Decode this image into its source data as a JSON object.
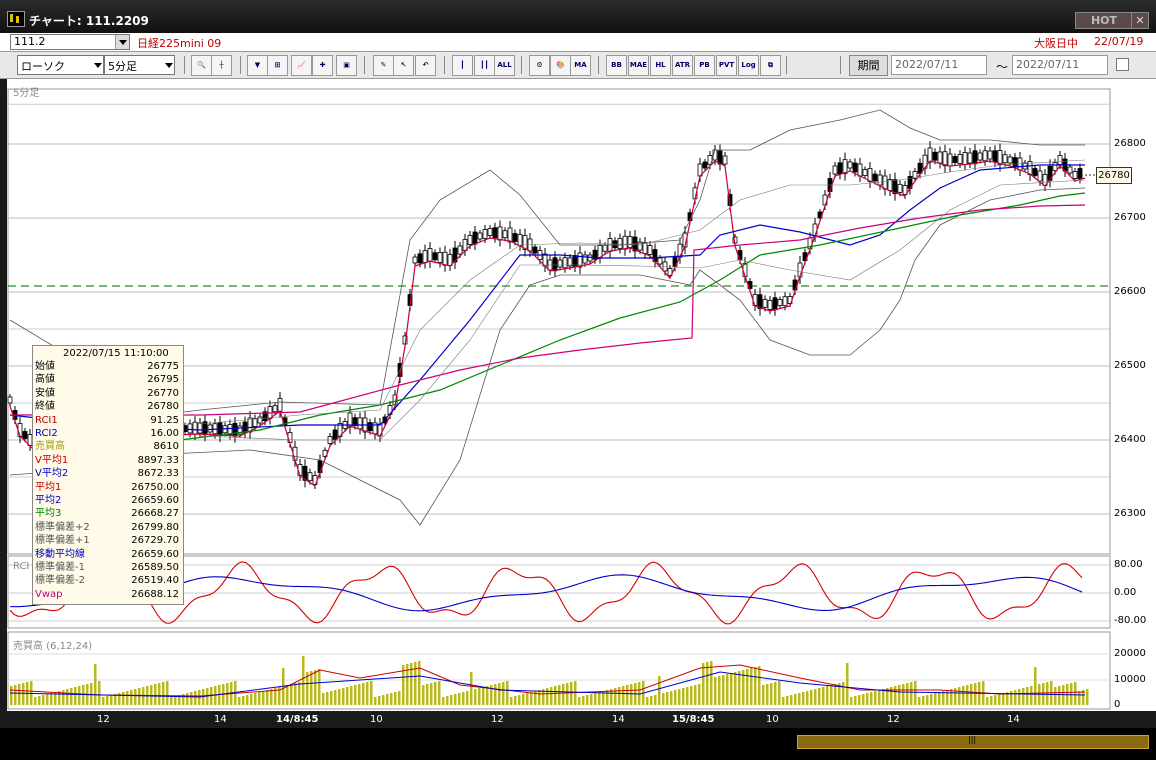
{
  "window": {
    "title": "チャート: 111.2209",
    "hot_label": "HOT",
    "close_glyph": "✕"
  },
  "header": {
    "symbol_code": "111.2",
    "contract_name": "日経225mini 09",
    "session": "大阪日中",
    "date": "22/07/19"
  },
  "toolbar": {
    "chart_type": "ローソク",
    "interval": "5分足",
    "period_button": "期間",
    "date_from": "2022/07/11",
    "date_to": "2022/07/11",
    "tilde": "～",
    "icons": [
      {
        "name": "zoom-icon",
        "glyph": "🔍"
      },
      {
        "name": "crosshair-icon",
        "glyph": "┼"
      },
      {
        "name": "mark-down-icon",
        "glyph": "▼"
      },
      {
        "name": "range-icon",
        "glyph": "⊞"
      },
      {
        "name": "trend-icon",
        "glyph": "📈"
      },
      {
        "name": "cross-compare-icon",
        "glyph": "✚"
      },
      {
        "name": "lock-icon",
        "glyph": "▣"
      },
      {
        "name": "pen-icon",
        "glyph": "✎"
      },
      {
        "name": "arrow-cursor-icon",
        "glyph": "↖"
      },
      {
        "name": "curve-icon",
        "glyph": "↶"
      },
      {
        "name": "candle-icon",
        "glyph": "┃"
      },
      {
        "name": "multi-candle-icon",
        "glyph": "┃┃"
      },
      {
        "name": "all-icon",
        "glyph": "ALL"
      },
      {
        "name": "settings-icon",
        "glyph": "⚙"
      },
      {
        "name": "color-icon",
        "glyph": "🎨"
      },
      {
        "name": "ma-icon",
        "glyph": "MA"
      },
      {
        "name": "bb-icon",
        "glyph": "BB"
      },
      {
        "name": "mae-icon",
        "glyph": "MAE"
      },
      {
        "name": "hl-icon",
        "glyph": "HL"
      },
      {
        "name": "atr-icon",
        "glyph": "ATR"
      },
      {
        "name": "pb-icon",
        "glyph": "PB"
      },
      {
        "name": "pvt-icon",
        "glyph": "PVT"
      },
      {
        "name": "log-icon",
        "glyph": "Log"
      },
      {
        "name": "window-icon",
        "glyph": "⧉"
      }
    ]
  },
  "chart": {
    "panel_main": "5分足",
    "panel_rci": "RCI",
    "panel_volume": "売買高 (6,12,24)",
    "price_axis": [
      "26800",
      "26700",
      "26600",
      "26500",
      "26400",
      "26300"
    ],
    "rci_axis": [
      "80.00",
      "0.00",
      "-80.00"
    ],
    "vol_axis": [
      "20000",
      "10000",
      "0"
    ],
    "last_price": "26780",
    "x_labels": [
      {
        "text": "12",
        "bold": false
      },
      {
        "text": "14",
        "bold": false
      },
      {
        "text": "14/8:45",
        "bold": true
      },
      {
        "text": "10",
        "bold": false
      },
      {
        "text": "12",
        "bold": false
      },
      {
        "text": "14",
        "bold": false
      },
      {
        "text": "15/8:45",
        "bold": true
      },
      {
        "text": "10",
        "bold": false
      },
      {
        "text": "12",
        "bold": false
      },
      {
        "text": "14",
        "bold": false
      }
    ],
    "colors": {
      "rci1": "#d40000",
      "rci2": "#0000cc",
      "ma1": "#cc0033",
      "ma2": "#0000cc",
      "ma3": "#008800",
      "vwap": "#cc0077",
      "bb": "#555555",
      "volume": "#b8b820",
      "dash": "#2a8a2a"
    }
  },
  "info": {
    "datetime": "2022/07/15  11:10:00",
    "rows": [
      {
        "label": "始値",
        "value": "26775",
        "color": "#000"
      },
      {
        "label": "高値",
        "value": "26795",
        "color": "#000"
      },
      {
        "label": "安値",
        "value": "26770",
        "color": "#000"
      },
      {
        "label": "終値",
        "value": "26780",
        "color": "#000"
      },
      {
        "label": "RCI1",
        "value": "91.25",
        "color": "#c00000"
      },
      {
        "label": "RCI2",
        "value": "16.00",
        "color": "#0000c0"
      },
      {
        "label": "売買高",
        "value": "8610",
        "color": "#a0a000"
      },
      {
        "label": "V平均1",
        "value": "8897.33",
        "color": "#c00000"
      },
      {
        "label": "V平均2",
        "value": "8672.33",
        "color": "#0000c0"
      },
      {
        "label": "平均1",
        "value": "26750.00",
        "color": "#c00000"
      },
      {
        "label": "平均2",
        "value": "26659.60",
        "color": "#0000c0"
      },
      {
        "label": "平均3",
        "value": "26668.27",
        "color": "#008000"
      },
      {
        "label": "標準偏差+2",
        "value": "26799.80",
        "color": "#555"
      },
      {
        "label": "標準偏差+1",
        "value": "26729.70",
        "color": "#555"
      },
      {
        "label": "移動平均線",
        "value": "26659.60",
        "color": "#0000c0"
      },
      {
        "label": "標準偏差-1",
        "value": "26589.50",
        "color": "#555"
      },
      {
        "label": "標準偏差-2",
        "value": "26519.40",
        "color": "#555"
      },
      {
        "label": "Vwap",
        "value": "26688.12",
        "color": "#c00080"
      }
    ]
  }
}
